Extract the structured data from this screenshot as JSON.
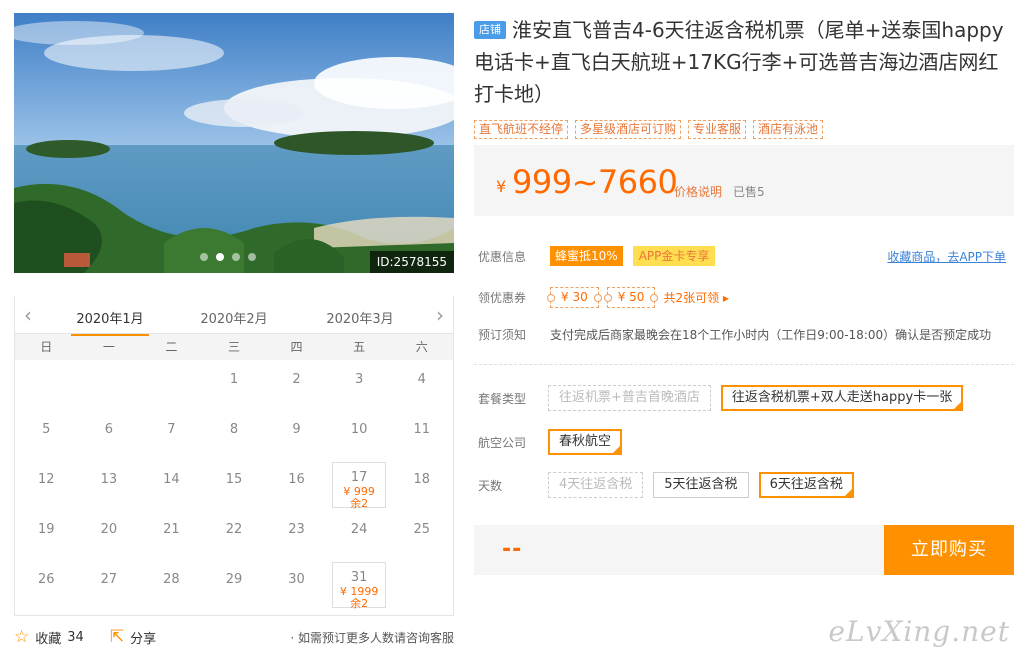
{
  "photo": {
    "id_label": "ID:2578155"
  },
  "calendar": {
    "tabs": [
      "2020年1月",
      "2020年2月",
      "2020年3月"
    ],
    "weekdays": [
      "日",
      "一",
      "二",
      "三",
      "四",
      "五",
      "六"
    ],
    "days": [
      {
        "d": ""
      },
      {
        "d": ""
      },
      {
        "d": ""
      },
      {
        "d": "1"
      },
      {
        "d": "2"
      },
      {
        "d": "3"
      },
      {
        "d": "4"
      },
      {
        "d": "5"
      },
      {
        "d": "6"
      },
      {
        "d": "7"
      },
      {
        "d": "8"
      },
      {
        "d": "9"
      },
      {
        "d": "10"
      },
      {
        "d": "11"
      },
      {
        "d": "12"
      },
      {
        "d": "13"
      },
      {
        "d": "14"
      },
      {
        "d": "15"
      },
      {
        "d": "16"
      },
      {
        "d": "17",
        "price": "¥ 999",
        "left": "余2"
      },
      {
        "d": "18"
      },
      {
        "d": "19"
      },
      {
        "d": "20"
      },
      {
        "d": "21"
      },
      {
        "d": "22"
      },
      {
        "d": "23"
      },
      {
        "d": "24"
      },
      {
        "d": "25"
      },
      {
        "d": "26"
      },
      {
        "d": "27"
      },
      {
        "d": "28"
      },
      {
        "d": "29"
      },
      {
        "d": "30"
      },
      {
        "d": "31",
        "price": "¥ 1999",
        "left": "余2"
      },
      {
        "d": ""
      }
    ]
  },
  "footer": {
    "fav_label": "收藏",
    "fav_count": "34",
    "share_label": "分享",
    "help_text": "· 如需预订更多人数请咨询客服"
  },
  "product": {
    "shop_tag": "店铺",
    "title": "淮安直飞普吉4-6天往返含税机票（尾单+送泰国happy电话卡+直飞白天航班+17KG行李+可选普吉海边酒店网红打卡地）",
    "tags": [
      "直飞航班不经停",
      "多星级酒店可订购",
      "专业客服",
      "酒店有泳池"
    ],
    "price_symbol": "¥",
    "price_range": "999~7660",
    "price_explain": "价格说明",
    "sold": "已售5"
  },
  "offers": {
    "label": "优惠信息",
    "badge1": "蜂蜜抵10%",
    "badge2": "APP金卡专享",
    "link": "收藏商品，去APP下单"
  },
  "coupons": {
    "label": "领优惠券",
    "items": [
      "¥ 30",
      "¥ 50"
    ],
    "more": "共2张可领 ▸"
  },
  "notice": {
    "label": "预订须知",
    "text": "支付完成后商家最晚会在18个工作小时内（工作日9:00-18:00）确认是否预定成功"
  },
  "options": {
    "package": {
      "label": "套餐类型",
      "items": [
        {
          "text": "往返机票+普吉首晚酒店",
          "state": "disabled"
        },
        {
          "text": "往返含税机票+双人走送happy卡一张",
          "state": "selected"
        }
      ]
    },
    "airline": {
      "label": "航空公司",
      "items": [
        {
          "text": "春秋航空",
          "state": "selected"
        }
      ]
    },
    "days": {
      "label": "天数",
      "items": [
        {
          "text": "4天往返含税",
          "state": "disabled"
        },
        {
          "text": "5天往返含税",
          "state": "normal"
        },
        {
          "text": "6天往返含税",
          "state": "selected"
        }
      ]
    }
  },
  "buy": {
    "total": "--",
    "button": "立即购买"
  },
  "watermark": "eLvXing.net",
  "colors": {
    "accent": "#ff9100",
    "price": "#ff6a00",
    "link": "#3b83d8",
    "shop_tag": "#4a9be8"
  }
}
